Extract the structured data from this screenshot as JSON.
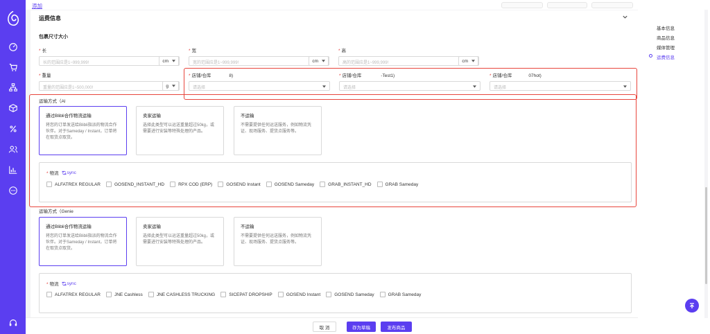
{
  "topbar": {
    "add_link": "添加"
  },
  "section": {
    "title": "运费信息",
    "package_title": "包裹尺寸大小"
  },
  "dimensions": {
    "length": {
      "label": "长",
      "placeholder": "长的范围应是1~999,999!",
      "unit": "cm"
    },
    "width": {
      "label": "宽",
      "placeholder": "宽的范围应是1~999,999!",
      "unit": "cm"
    },
    "height": {
      "label": "高",
      "placeholder": "高的范围应是1~999,999!",
      "unit": "cm"
    },
    "weight": {
      "label": "重量",
      "placeholder": "重量的范围应是1~500,000!",
      "unit": "g"
    }
  },
  "warehouses": [
    {
      "label": "店铺/仓库",
      "suffix": "8)",
      "placeholder": "请选择"
    },
    {
      "label": "店铺/仓库",
      "suffix": "-Test1)",
      "placeholder": "请选择"
    },
    {
      "label": "店铺/仓库",
      "suffix": "07hot)",
      "placeholder": "请选择"
    }
  ],
  "shipping_groups": [
    {
      "label": "运输方式（Al",
      "options": [
        {
          "title": "通过Blibli合作物流运输",
          "desc": "将您的订单发送给Blibli指派的物流合作伙伴。对于Sameday / Instant，订单将在取货点取货。",
          "active": true
        },
        {
          "title": "卖家运输",
          "desc": "选择此类型可以运送重量超过50kg，或需要进行安装等特殊处理的产品。",
          "active": false
        },
        {
          "title": "不运输",
          "desc": "不需要提供任何运送服务，例如物流凭证、现场服务、提货点服务等。",
          "active": false
        }
      ],
      "logistics_label": "物流",
      "sync_label": "sync",
      "carriers": [
        "ALFATREX REGULAR",
        "GOSEND_INSTANT_HD",
        "RPX COD (ERP)",
        "GOSEND Instant",
        "GOSEND Sameday",
        "GRAB_INSTANT_HD",
        "GRAB Sameday"
      ]
    },
    {
      "label": "运输方式（Genie",
      "options": [
        {
          "title": "通过Blibli合作物流运输",
          "desc": "将您的订单发送给Blibli指派的物流合作伙伴。对于Sameday / Instant，订单将在取货点取货。",
          "active": true
        },
        {
          "title": "卖家运输",
          "desc": "选择此类型可以运送重量超过50kg，或需要进行安装等特殊处理的产品。",
          "active": false
        },
        {
          "title": "不运输",
          "desc": "不需要提供任何运送服务，例如物流凭证、现场服务、提货点服务等。",
          "active": false
        }
      ],
      "logistics_label": "物流",
      "sync_label": "sync",
      "carriers": [
        "ALFATREX REGULAR",
        "JNE Cashless",
        "JNE CASHLESS TRUCKING",
        "SICEPAT DROPSHIP",
        "GOSEND Instant",
        "GOSEND Sameday",
        "GRAB Sameday"
      ]
    }
  ],
  "footer": {
    "cancel": "取 消",
    "save_draft": "存为草稿",
    "publish": "发布商品"
  },
  "anchor_nav": [
    "基本信息",
    "商品信息",
    "媒体管理",
    "运费信息"
  ],
  "colors": {
    "primary": "#5b3ef0",
    "highlight": "#e8453c"
  }
}
